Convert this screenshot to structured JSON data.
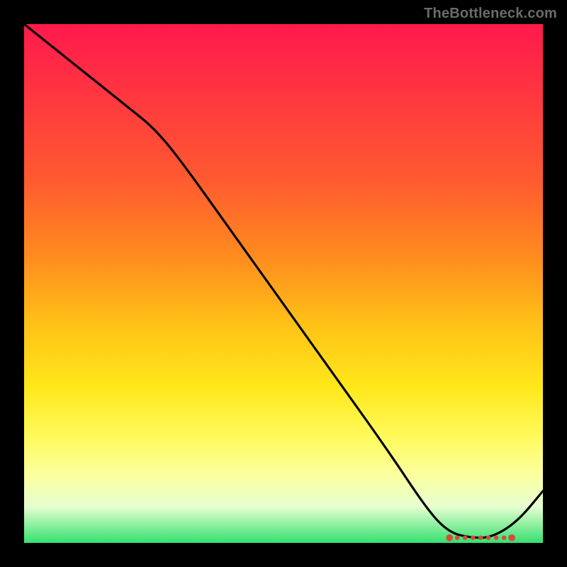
{
  "attribution": "TheBottleneck.com",
  "colors": {
    "frame": "#000000",
    "gradient_stops": [
      "#ff1a4d",
      "#ff2a45",
      "#ff5a30",
      "#ff8c1e",
      "#ffc217",
      "#ffe81a",
      "#fffb60",
      "#fbffa0",
      "#e6ffd0",
      "#35e070"
    ],
    "curve": "#000000",
    "markers": "#d94a3a"
  },
  "chart_data": {
    "type": "line",
    "title": "",
    "xlabel": "",
    "ylabel": "",
    "xlim": [
      0,
      100
    ],
    "ylim": [
      0,
      100
    ],
    "series": [
      {
        "name": "curve",
        "x": [
          0,
          10,
          20,
          25,
          30,
          40,
          50,
          60,
          70,
          78,
          82,
          86,
          90,
          95,
          100
        ],
        "y": [
          100,
          92,
          84,
          80,
          74,
          60,
          46,
          32,
          18,
          6,
          2,
          1,
          1,
          4,
          10
        ]
      }
    ],
    "markers": {
      "name": "bottom-cluster",
      "x": [
        82,
        83.5,
        85,
        86.5,
        88,
        89.5,
        91,
        92.5,
        94
      ],
      "y": [
        1,
        1,
        1,
        1,
        1,
        1,
        1,
        1,
        1
      ]
    }
  }
}
